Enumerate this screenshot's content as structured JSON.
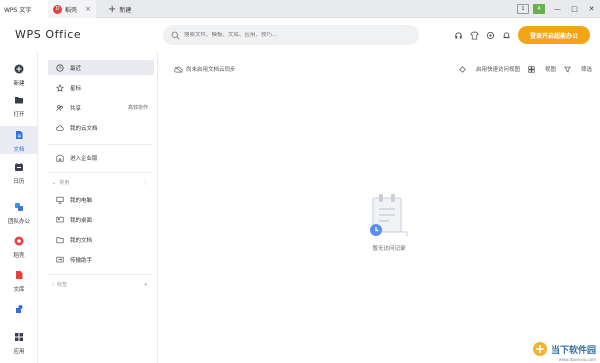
{
  "tabs": [
    {
      "label": "WPS 文字"
    },
    {
      "label": "稻壳",
      "badge": "D"
    },
    {
      "label": "新建"
    }
  ],
  "window": {
    "badge1": "1",
    "badge2": "4"
  },
  "brand": "WPS Office",
  "search": {
    "placeholder": "搜索文件、模板、文库、应用、技巧..."
  },
  "header_icons": [
    "headset-icon",
    "skin-icon",
    "settings-icon",
    "bell-icon"
  ],
  "login_button": "登录开启超能办公",
  "rail": [
    {
      "label": "新建",
      "icon": "plus-circle-icon"
    },
    {
      "label": "打开",
      "icon": "folder-icon"
    },
    {
      "label": "文档",
      "icon": "document-icon",
      "active": true
    },
    {
      "label": "日历",
      "icon": "calendar-icon"
    },
    {
      "label": "团队办公",
      "icon": "team-icon"
    },
    {
      "label": "稻壳",
      "icon": "daoke-icon"
    },
    {
      "label": "文库",
      "icon": "library-icon"
    },
    {
      "label": "应用",
      "icon": "apps-icon"
    }
  ],
  "sidebar": {
    "items": [
      {
        "label": "最近",
        "icon": "clock-icon",
        "active": true
      },
      {
        "label": "星标",
        "icon": "star-icon"
      },
      {
        "label": "共享",
        "icon": "share-icon",
        "sub": "高效协作"
      },
      {
        "label": "我的云文档",
        "icon": "cloud-icon"
      }
    ],
    "enterprise": {
      "label": "进入企业版",
      "icon": "enterprise-icon"
    },
    "common_title": "常用",
    "common": [
      {
        "label": "我的电脑",
        "icon": "computer-icon"
      },
      {
        "label": "我的桌面",
        "icon": "desktop-icon"
      },
      {
        "label": "我的文档",
        "icon": "mydocs-icon"
      },
      {
        "label": "传输助手",
        "icon": "transfer-icon"
      }
    ],
    "tags_title": "标签"
  },
  "main": {
    "cloud_tip": "尚未启用文档云同步",
    "tools": [
      {
        "label": "启用快速访问视图",
        "icon": "quick-access-icon"
      },
      {
        "label": "视图",
        "icon": "view-icon"
      },
      {
        "label": "筛选",
        "icon": "filter-icon"
      }
    ],
    "empty_text": "暂无访问记录"
  },
  "watermark": {
    "text": "当下软件园",
    "sub": "www.downxia.com"
  },
  "colors": {
    "accent": "#f2a516",
    "active_bg": "#e8eaef",
    "blue": "#2f6fe4",
    "red": "#e8413d"
  }
}
